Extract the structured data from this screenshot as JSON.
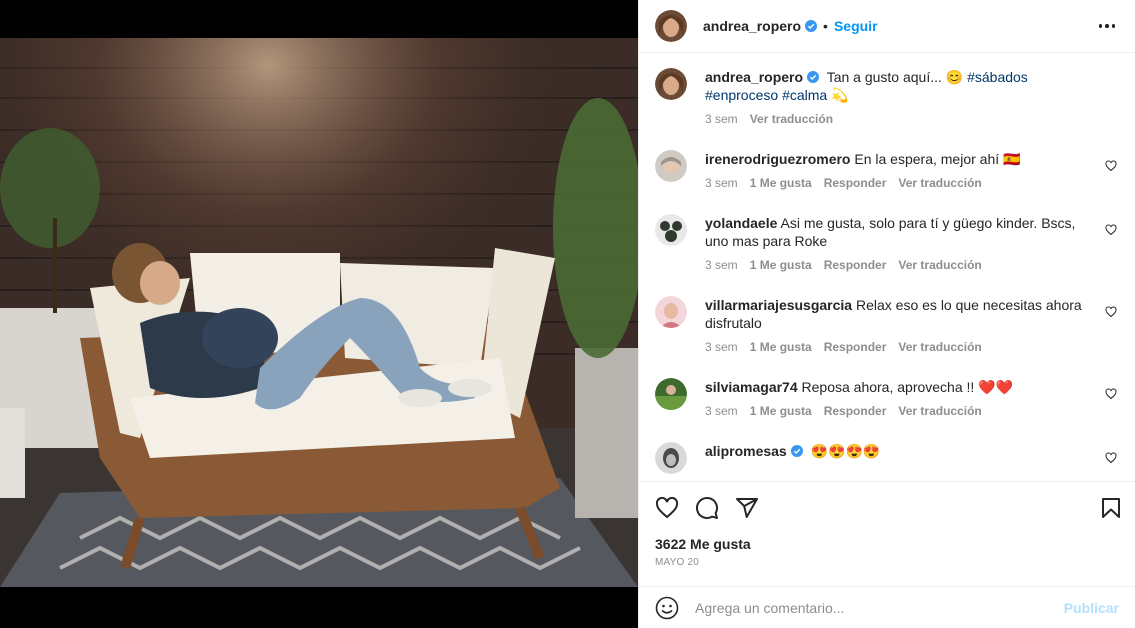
{
  "post": {
    "username": "andrea_ropero",
    "follow_label": "Seguir",
    "dot": "•",
    "caption": {
      "text": "Tan a gusto aquí... 😊 ",
      "hashtag1": "#sábados",
      "hashtag2": "#enproceso",
      "hashtag3": "#calma",
      "emoji_end": " 💫",
      "time": "3 sem",
      "translate": "Ver traducción"
    }
  },
  "comments": [
    {
      "username": "irenerodriguezromero",
      "text": "En la espera, mejor ahí 🇪🇸",
      "time": "3 sem",
      "likes": "1 Me gusta",
      "reply": "Responder",
      "translate": "Ver traducción"
    },
    {
      "username": "yolandaele",
      "text": "Asi me gusta, solo para tí y güego kinder. Bscs, uno mas para Roke",
      "time": "3 sem",
      "likes": "1 Me gusta",
      "reply": "Responder",
      "translate": "Ver traducción"
    },
    {
      "username": "villarmariajesusgarcia",
      "text": "Relax eso es lo que necesitas ahora disfrutalo",
      "time": "3 sem",
      "likes": "1 Me gusta",
      "reply": "Responder",
      "translate": "Ver traducción"
    },
    {
      "username": "silviamagar74",
      "text": "Reposa ahora, aprovecha !! ❤️❤️",
      "time": "3 sem",
      "likes": "1 Me gusta",
      "reply": "Responder",
      "translate": "Ver traducción"
    },
    {
      "username": "alipromesas",
      "text": "😍😍😍😍"
    }
  ],
  "footer": {
    "likes": "3622 Me gusta",
    "date": "MAYO 20",
    "comment_placeholder": "Agrega un comentario...",
    "publish_label": "Publicar"
  },
  "colors": {
    "accent": "#0095f6",
    "verified": "#3897f0",
    "publish_disabled": "#b2dffc"
  },
  "icons": [
    "more-options-icon",
    "verified-badge-icon",
    "heart-icon",
    "comment-icon",
    "share-icon",
    "bookmark-icon",
    "emoji-icon"
  ]
}
